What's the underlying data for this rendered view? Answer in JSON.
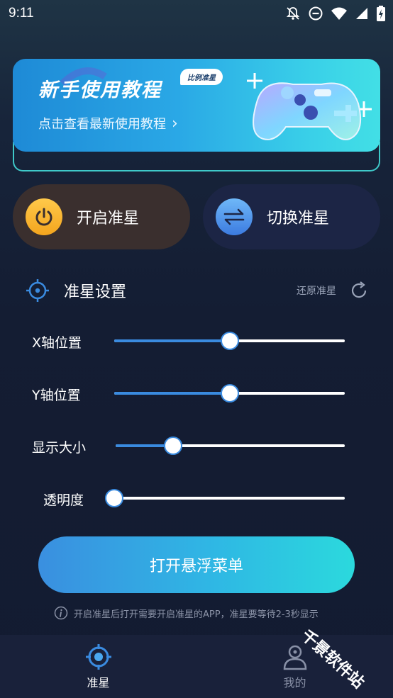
{
  "status_bar": {
    "time": "9:11",
    "icons": [
      "notifications-off-icon",
      "do-not-disturb-icon",
      "wifi-icon",
      "signal-icon",
      "battery-charging-icon"
    ]
  },
  "banner": {
    "title": "新手使用教程",
    "tag": "比例准星",
    "subtitle": "点击查看最新使用教程",
    "arrow": "›"
  },
  "actions": {
    "enable_label": "开启准星",
    "switch_label": "切换准星"
  },
  "settings": {
    "title": "准星设置",
    "reset_label": "还原准星",
    "sliders": [
      {
        "label": "X轴位置",
        "value": 0.5
      },
      {
        "label": "Y轴位置",
        "value": 0.5
      },
      {
        "label": "显示大小",
        "value": 0.25
      },
      {
        "label": "透明度",
        "value": 0.0
      }
    ]
  },
  "float_button": {
    "label": "打开悬浮菜单"
  },
  "hint": {
    "text": "开启准星后打开需要开启准星的APP，准星要等待2-3秒显示"
  },
  "nav": {
    "items": [
      {
        "label": "准星",
        "icon": "crosshair-icon",
        "active": true
      },
      {
        "label": "我的",
        "icon": "user-icon",
        "active": false
      }
    ]
  },
  "watermark": "千景软件站",
  "colors": {
    "accent_blue": "#3a8be0",
    "accent_cyan": "#2bd9dd",
    "power_yellow": "#f4a51e",
    "background": "#141d33"
  }
}
